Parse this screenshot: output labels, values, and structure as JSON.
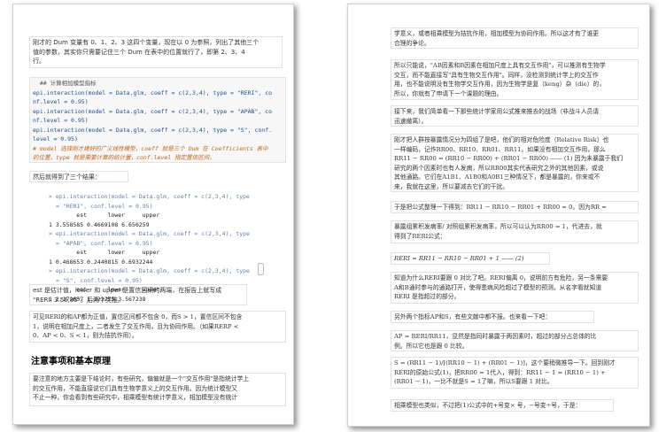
{
  "left": {
    "p1": [
      "刚才的 Dum 变量有 0、1、2、3 这四个变量，现在以 0 为参照，列出了其他三个",
      "值的参数，其实你只需要记住三个 Dum 在表中的位置就行了，即第 2、3、4",
      "行。"
    ],
    "code": {
      "comment": "  ## 计算相加模型指标",
      "lines": [
        "epi.interaction(model = Data.glm, coeff = c(2,3,4), type = \"RERI\", co",
        "nf.level = 0.95)",
        "epi.interaction(model = Data.glm, coeff = c(2,3,4), type = \"APAB\", co",
        "nf.level = 0.95)",
        "epi.interaction(model = Data.glm, coeff = c(2,3,4), type = \"S\", conf.",
        "level = 0.95)"
      ],
      "note": [
        "# model 选择刚才建好的广义线性模型，coeff 就是三个 Dum 在 Coefficients 表中",
        "的位置，type 就是需要计算的统计量，conf.level 指定置信区间。"
      ]
    },
    "p2": "然后就得到了三个结果：",
    "output": [
      {
        "cmd": [
          "> epi.interaction(model = Data.glm, coeff = c(2,3,4), type",
          "= \"RERI\", conf.level = 0.95)"
        ],
        "header": "        est      lower     upper",
        "row": "1 3.558585 0.4669108 6.650259"
      },
      {
        "cmd": [
          "> epi.interaction(model = Data.glm, coeff = c(2,3,4), type",
          "= \"APAB\", conf.level = 0.95)"
        ],
        "header": "        est      lower     upper",
        "row": "1 0.468653 0.2440815 0.6932244"
      },
      {
        "cmd": [
          "> epi.interaction(model = Data.glm, coeff = c(2,3,4), type",
          "= \"S\", conf.level = 0.95)"
        ],
        "header": "        est      lower     upper",
        "row": "1 2.172657 1.323275 3.567238"
      }
    ],
    "p3": [
      "est 是估计值，lower 和 upper 是置信区间的两端，在报告上就写成",
      "\"RERI: 3.56,95\"。后两个类推。"
    ],
    "p4": [
      "可见RERI的和AP都为正值，置信区间都不包含 0，而S > 1，置信区间不包含",
      "1，说明在相加尺度上，二者发生了交互作用，且为协同作用。（如果RERP <",
      "0、AP < 0、S < 1，则为拮抗作用）。"
    ],
    "heading": "注意事项和基本原理",
    "p5": [
      "要注意的地方主要是下结论时，有些研究，偏偏就是一个\"交互作用\"是指统计学上",
      "的交互作用，不能直接说它们具有生物学意义上的交互作用。因为统计模型又",
      "不止一种，你会看到有些研究中，相乘模型有统计学意义，相加模型没有统计"
    ]
  },
  "right": {
    "p1": [
      "学意义，或者相乘模型为拮抗作用，相加模型为协同作用。所以这才有了谁更",
      "合理的争论。"
    ],
    "p2": [
      "所以只能说，\"AB因素和B因素在相加尺度上具有交互作用\"，可以推测有生物学",
      "交互，而不能直接写\"具有生物交互作用\"。同样，没检测到统计学上的交互作",
      "用，也不能说明没有生物学交互作用，因为生物学是复（keng）杂（die）的，",
      "所以，你就有了申请下一个课题的理由。"
    ],
    "p3": [
      "接下来，我们简单看一下那些统计学家用公式推来推去的战场（非战斗人员请",
      "迅速撤离）。"
    ],
    "p4": [
      "刚才把人群按暴露情况分为四组了是吧，他们的相对危险度（Relative Risk）也",
      "一样编码，记作RR00、RR10、RR01、RR11。如果没有相加交互作用，那么",
      "RR11 − RR00 = (RR10 − RR00) + (RR01 − RR00) —— (1) 因为未暴露于我们",
      "研究的两个因素时也有人发病，所以RR00其实代表研究之外的其他因素，或说",
      "其他通路。它们在A1B1、A1B0和A0B1三种情况下，都是暴露的，你来或不",
      "来，我就在这里，所以要减去它们的干扰。"
    ],
    "p5": "于是把公式整理一下得到：RR11 − RR10 − RR01 + RR00 = 0。因为RR =",
    "p6": [
      "暴露组累积发病率/ 对照组累积发病率，所以可以认为RR00 = 1，代进去，就",
      "得到了RERI公式："
    ],
    "formula": "RERI = RR11 − RR10 − RR01 + 1 —— (2)",
    "p7": [
      "知道为什么RERI要跟 0 对比了吧。RERI偏离 0，说明前方有危险，另一条需要",
      "A和B通时参与的通路打开，使得患病风险超过了模型的预测。从名字看就知道",
      "RERI 是指超过的部分。"
    ],
    "p8": "另外两个指标AP和S，有些文献中都不报。也来看一下吧：",
    "p9": [
      "AP = RERI/RR11，显然是指同时暴露于两因素时，超过的部分占总体的比",
      "例。所以它也是跟 0 比较。"
    ],
    "p10": [
      "S = (RR11 − 1)/[(RR10 − 1) + (RR01 − 1)]，这个要稍微推导一下。回到刚才",
      "RERI的原始公式(1)，把RR00 = 1代入，得到：RR11 − 1 = (RR10 − 1) +",
      "(RR01 − 1)，一比不就是S = 1了嘛，所以S要跟 1 对比。"
    ],
    "p11": "相乘模型也类似，不过把(1)公式中的+号变× 号，−号变÷号，于是："
  }
}
